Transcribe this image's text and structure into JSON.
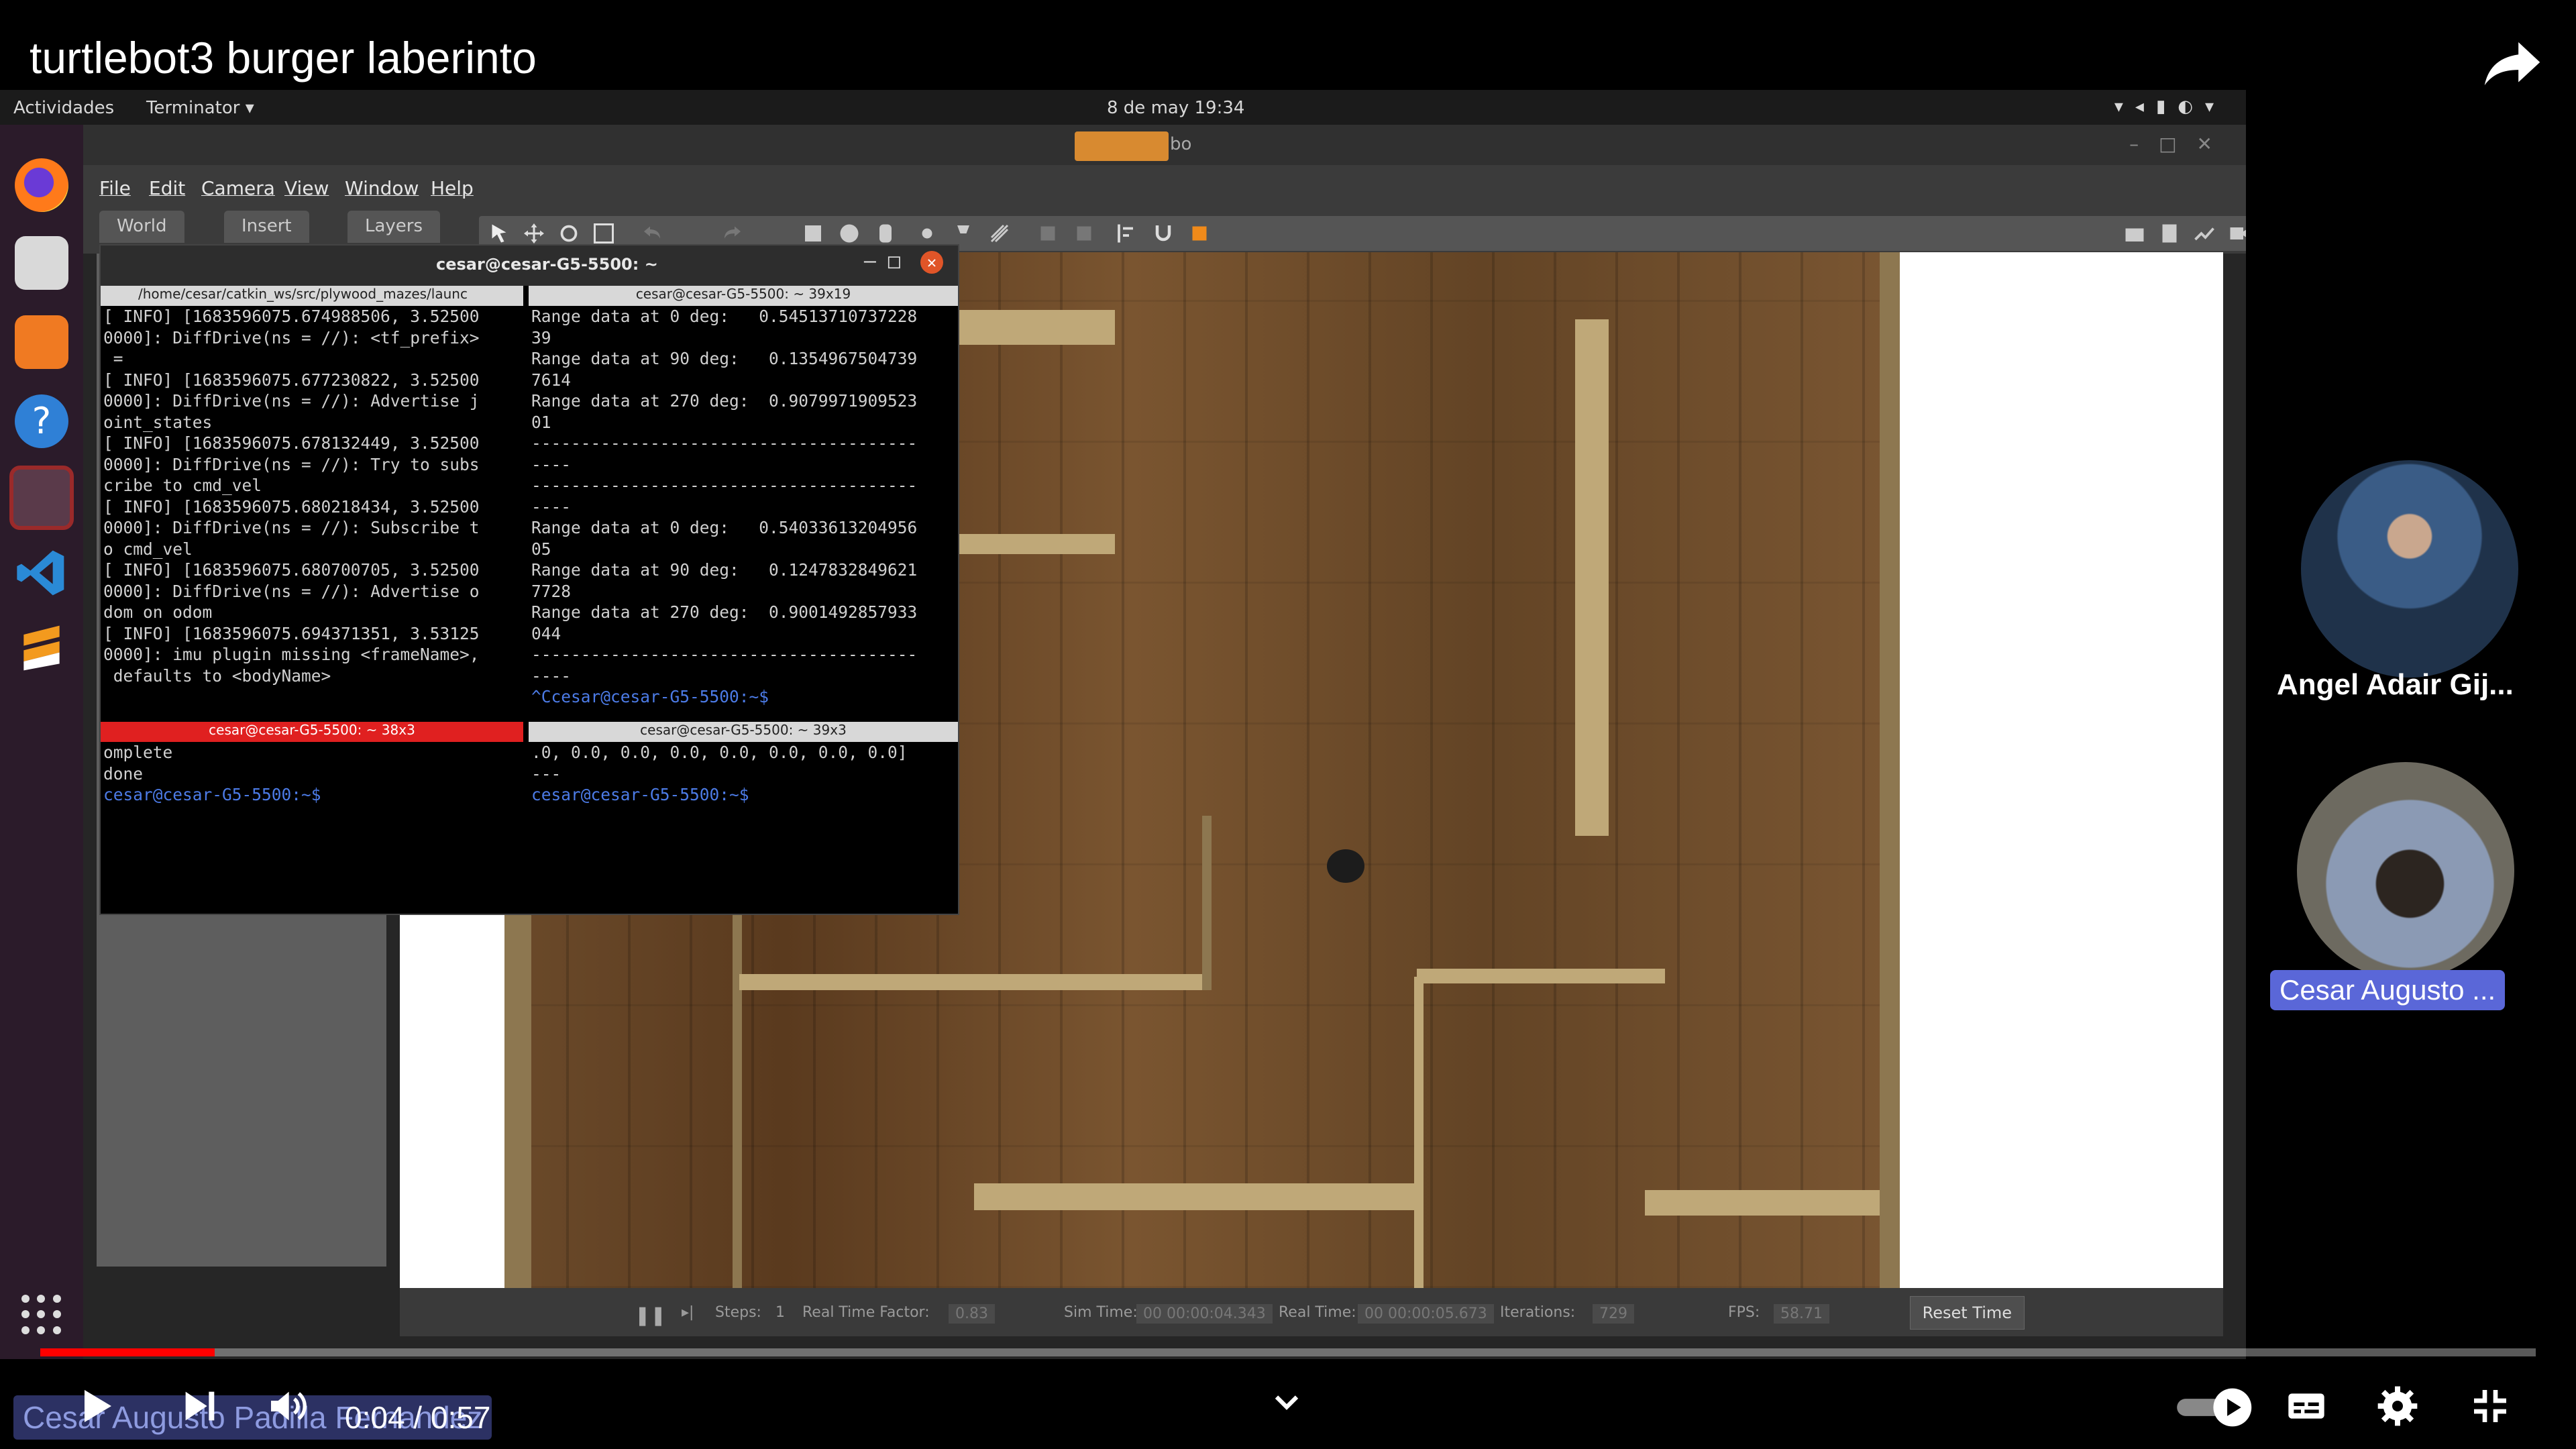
{
  "video": {
    "title": "turtlebot3 burger laberinto",
    "progress": 0.07,
    "time_current": "0:04",
    "time_separator": " / ",
    "time_total": "0:57",
    "overlay_name": "Cesar Augusto Padilla Fernandez"
  },
  "gnome": {
    "activities": "Actividades",
    "app_menu": "Terminator ▾",
    "clock": "8 de may  19:34"
  },
  "gazebo": {
    "title_suffix": "bo",
    "menu": [
      "File",
      "Edit",
      "Camera",
      "View",
      "Window",
      "Help"
    ],
    "tabs": [
      "World",
      "Insert",
      "Layers"
    ],
    "bottom": {
      "steps_label": "Steps:",
      "steps_value": "1",
      "rtf_label": "Real Time Factor:",
      "rtf_value": "0.83",
      "sim_label": "Sim Time:",
      "sim_value": "00 00:00:04.343",
      "real_label": "Real Time:",
      "real_value": "00 00:00:05.673",
      "iter_label": "Iterations:",
      "iter_value": "729",
      "fps_label": "FPS:",
      "fps_value": "58.71",
      "reset": "Reset Time"
    }
  },
  "terminator": {
    "title": "cesar@cesar-G5-5500: ~",
    "pane1_head": "/home/cesar/catkin_ws/src/plywood_mazes/launc",
    "pane1_body": "[ INFO] [1683596075.674988506, 3.52500\n0000]: DiffDrive(ns = //): <tf_prefix>\n =\n[ INFO] [1683596075.677230822, 3.52500\n0000]: DiffDrive(ns = //): Advertise j\noint_states\n[ INFO] [1683596075.678132449, 3.52500\n0000]: DiffDrive(ns = //): Try to subs\ncribe to cmd_vel\n[ INFO] [1683596075.680218434, 3.52500\n0000]: DiffDrive(ns = //): Subscribe t\no cmd_vel\n[ INFO] [1683596075.680700705, 3.52500\n0000]: DiffDrive(ns = //): Advertise o\ndom on odom\n[ INFO] [1683596075.694371351, 3.53125\n0000]: imu plugin missing <frameName>,\n defaults to <bodyName>\n",
    "pane2_head": "cesar@cesar-G5-5500: ~ 39x19",
    "pane2_body": "Range data at 0 deg:   0.54513710737228\n39\nRange data at 90 deg:   0.1354967504739\n7614\nRange data at 270 deg:  0.9079971909523\n01\n---------------------------------------\n----\n---------------------------------------\n----\nRange data at 0 deg:   0.54033613204956\n05\nRange data at 90 deg:   0.1247832849621\n7728\nRange data at 270 deg:  0.9001492857933\n044\n---------------------------------------\n----",
    "pane2_prompt": "^Ccesar@cesar-G5-5500:~$ ",
    "pane3_head": "cesar@cesar-G5-5500: ~ 38x3",
    "pane3_body": "omplete\ndone",
    "pane3_prompt": "cesar@cesar-G5-5500:~$ ",
    "pane4_head": "cesar@cesar-G5-5500: ~ 39x3",
    "pane4_body": ".0, 0.0, 0.0, 0.0, 0.0, 0.0, 0.0, 0.0]\n---",
    "pane4_prompt": "cesar@cesar-G5-5500:~$ "
  },
  "participants": [
    {
      "name": "Angel Adair Gij..."
    },
    {
      "name": "Cesar Augusto ..."
    }
  ],
  "colors": {
    "youtube_red": "#ff0000",
    "terminal_active": "#e02020",
    "prompt_blue": "#4c7be6",
    "name_badge": "#5a67d8"
  },
  "icons": [
    "share-icon",
    "firefox-icon",
    "files-icon",
    "software-icon",
    "help-icon",
    "terminator-icon",
    "vscode-icon",
    "sublime-icon",
    "apps-grid-icon",
    "play-icon",
    "next-icon",
    "volume-icon",
    "chevron-down-icon",
    "autoplay-toggle-icon",
    "subtitles-icon",
    "settings-icon",
    "exit-fullscreen-icon"
  ]
}
